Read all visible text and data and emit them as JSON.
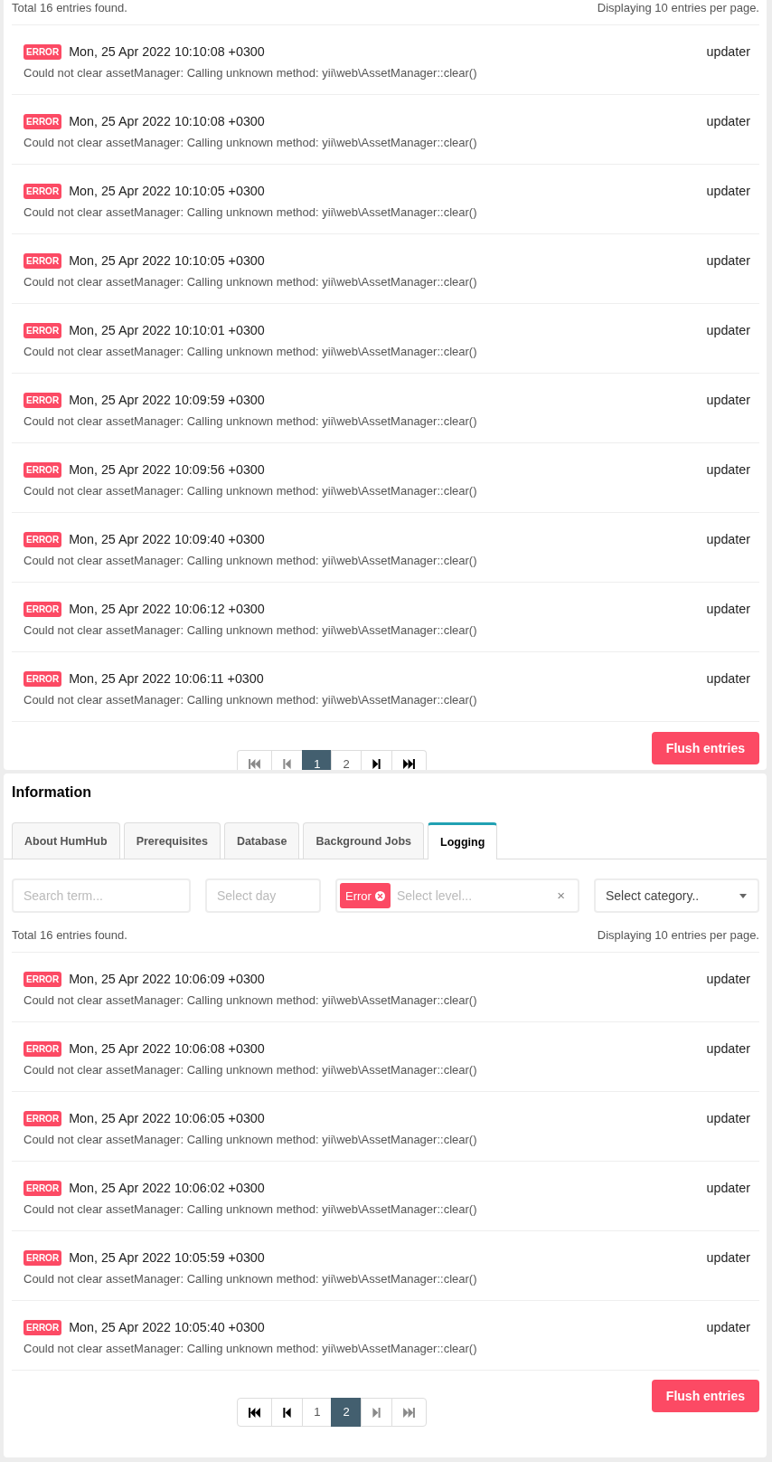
{
  "log_top": {
    "summary": "Total 16 entries found.",
    "per_page": "Displaying 10 entries per page.",
    "entries": [
      {
        "level": "ERROR",
        "time": "Mon, 25 Apr 2022 10:10:08 +0300",
        "category": "updater",
        "message": "Could not clear assetManager: Calling unknown method: yii\\web\\AssetManager::clear()"
      },
      {
        "level": "ERROR",
        "time": "Mon, 25 Apr 2022 10:10:08 +0300",
        "category": "updater",
        "message": "Could not clear assetManager: Calling unknown method: yii\\web\\AssetManager::clear()"
      },
      {
        "level": "ERROR",
        "time": "Mon, 25 Apr 2022 10:10:05 +0300",
        "category": "updater",
        "message": "Could not clear assetManager: Calling unknown method: yii\\web\\AssetManager::clear()"
      },
      {
        "level": "ERROR",
        "time": "Mon, 25 Apr 2022 10:10:05 +0300",
        "category": "updater",
        "message": "Could not clear assetManager: Calling unknown method: yii\\web\\AssetManager::clear()"
      },
      {
        "level": "ERROR",
        "time": "Mon, 25 Apr 2022 10:10:01 +0300",
        "category": "updater",
        "message": "Could not clear assetManager: Calling unknown method: yii\\web\\AssetManager::clear()"
      },
      {
        "level": "ERROR",
        "time": "Mon, 25 Apr 2022 10:09:59 +0300",
        "category": "updater",
        "message": "Could not clear assetManager: Calling unknown method: yii\\web\\AssetManager::clear()"
      },
      {
        "level": "ERROR",
        "time": "Mon, 25 Apr 2022 10:09:56 +0300",
        "category": "updater",
        "message": "Could not clear assetManager: Calling unknown method: yii\\web\\AssetManager::clear()"
      },
      {
        "level": "ERROR",
        "time": "Mon, 25 Apr 2022 10:09:40 +0300",
        "category": "updater",
        "message": "Could not clear assetManager: Calling unknown method: yii\\web\\AssetManager::clear()"
      },
      {
        "level": "ERROR",
        "time": "Mon, 25 Apr 2022 10:06:12 +0300",
        "category": "updater",
        "message": "Could not clear assetManager: Calling unknown method: yii\\web\\AssetManager::clear()"
      },
      {
        "level": "ERROR",
        "time": "Mon, 25 Apr 2022 10:06:11 +0300",
        "category": "updater",
        "message": "Could not clear assetManager: Calling unknown method: yii\\web\\AssetManager::clear()"
      }
    ],
    "pagination": [
      {
        "kind": "first",
        "disabled": true
      },
      {
        "kind": "prev",
        "disabled": true
      },
      {
        "kind": "page",
        "label": "1",
        "selected": true
      },
      {
        "kind": "page",
        "label": "2",
        "selected": false
      },
      {
        "kind": "next",
        "disabled": false
      },
      {
        "kind": "last",
        "disabled": false
      }
    ],
    "flush_button": "Flush entries"
  },
  "information": {
    "title": "Information",
    "tabs": [
      {
        "label": "About HumHub",
        "selected": false
      },
      {
        "label": "Prerequisites",
        "selected": false
      },
      {
        "label": "Database",
        "selected": false
      },
      {
        "label": "Background Jobs",
        "selected": false
      },
      {
        "label": "Logging",
        "selected": true
      }
    ],
    "filters": {
      "search": {
        "placeholder": "Search term..."
      },
      "day": {
        "placeholder": "Select day"
      },
      "level": {
        "tags": [
          "Error"
        ],
        "placeholder": "Select level...",
        "clear": "×"
      },
      "category": {
        "prompt": "Select category.."
      }
    },
    "summary": "Total 16 entries found.",
    "per_page": "Displaying 10 entries per page.",
    "entries": [
      {
        "level": "ERROR",
        "time": "Mon, 25 Apr 2022 10:06:09 +0300",
        "category": "updater",
        "message": "Could not clear assetManager: Calling unknown method: yii\\web\\AssetManager::clear()"
      },
      {
        "level": "ERROR",
        "time": "Mon, 25 Apr 2022 10:06:08 +0300",
        "category": "updater",
        "message": "Could not clear assetManager: Calling unknown method: yii\\web\\AssetManager::clear()"
      },
      {
        "level": "ERROR",
        "time": "Mon, 25 Apr 2022 10:06:05 +0300",
        "category": "updater",
        "message": "Could not clear assetManager: Calling unknown method: yii\\web\\AssetManager::clear()"
      },
      {
        "level": "ERROR",
        "time": "Mon, 25 Apr 2022 10:06:02 +0300",
        "category": "updater",
        "message": "Could not clear assetManager: Calling unknown method: yii\\web\\AssetManager::clear()"
      },
      {
        "level": "ERROR",
        "time": "Mon, 25 Apr 2022 10:05:59 +0300",
        "category": "updater",
        "message": "Could not clear assetManager: Calling unknown method: yii\\web\\AssetManager::clear()"
      },
      {
        "level": "ERROR",
        "time": "Mon, 25 Apr 2022 10:05:40 +0300",
        "category": "updater",
        "message": "Could not clear assetManager: Calling unknown method: yii\\web\\AssetManager::clear()"
      }
    ],
    "pagination": [
      {
        "kind": "first",
        "disabled": false
      },
      {
        "kind": "prev",
        "disabled": false
      },
      {
        "kind": "page",
        "label": "1",
        "selected": false
      },
      {
        "kind": "page",
        "label": "2",
        "selected": true
      },
      {
        "kind": "next",
        "disabled": true
      },
      {
        "kind": "last",
        "disabled": true
      }
    ],
    "flush_button": "Flush entries"
  }
}
